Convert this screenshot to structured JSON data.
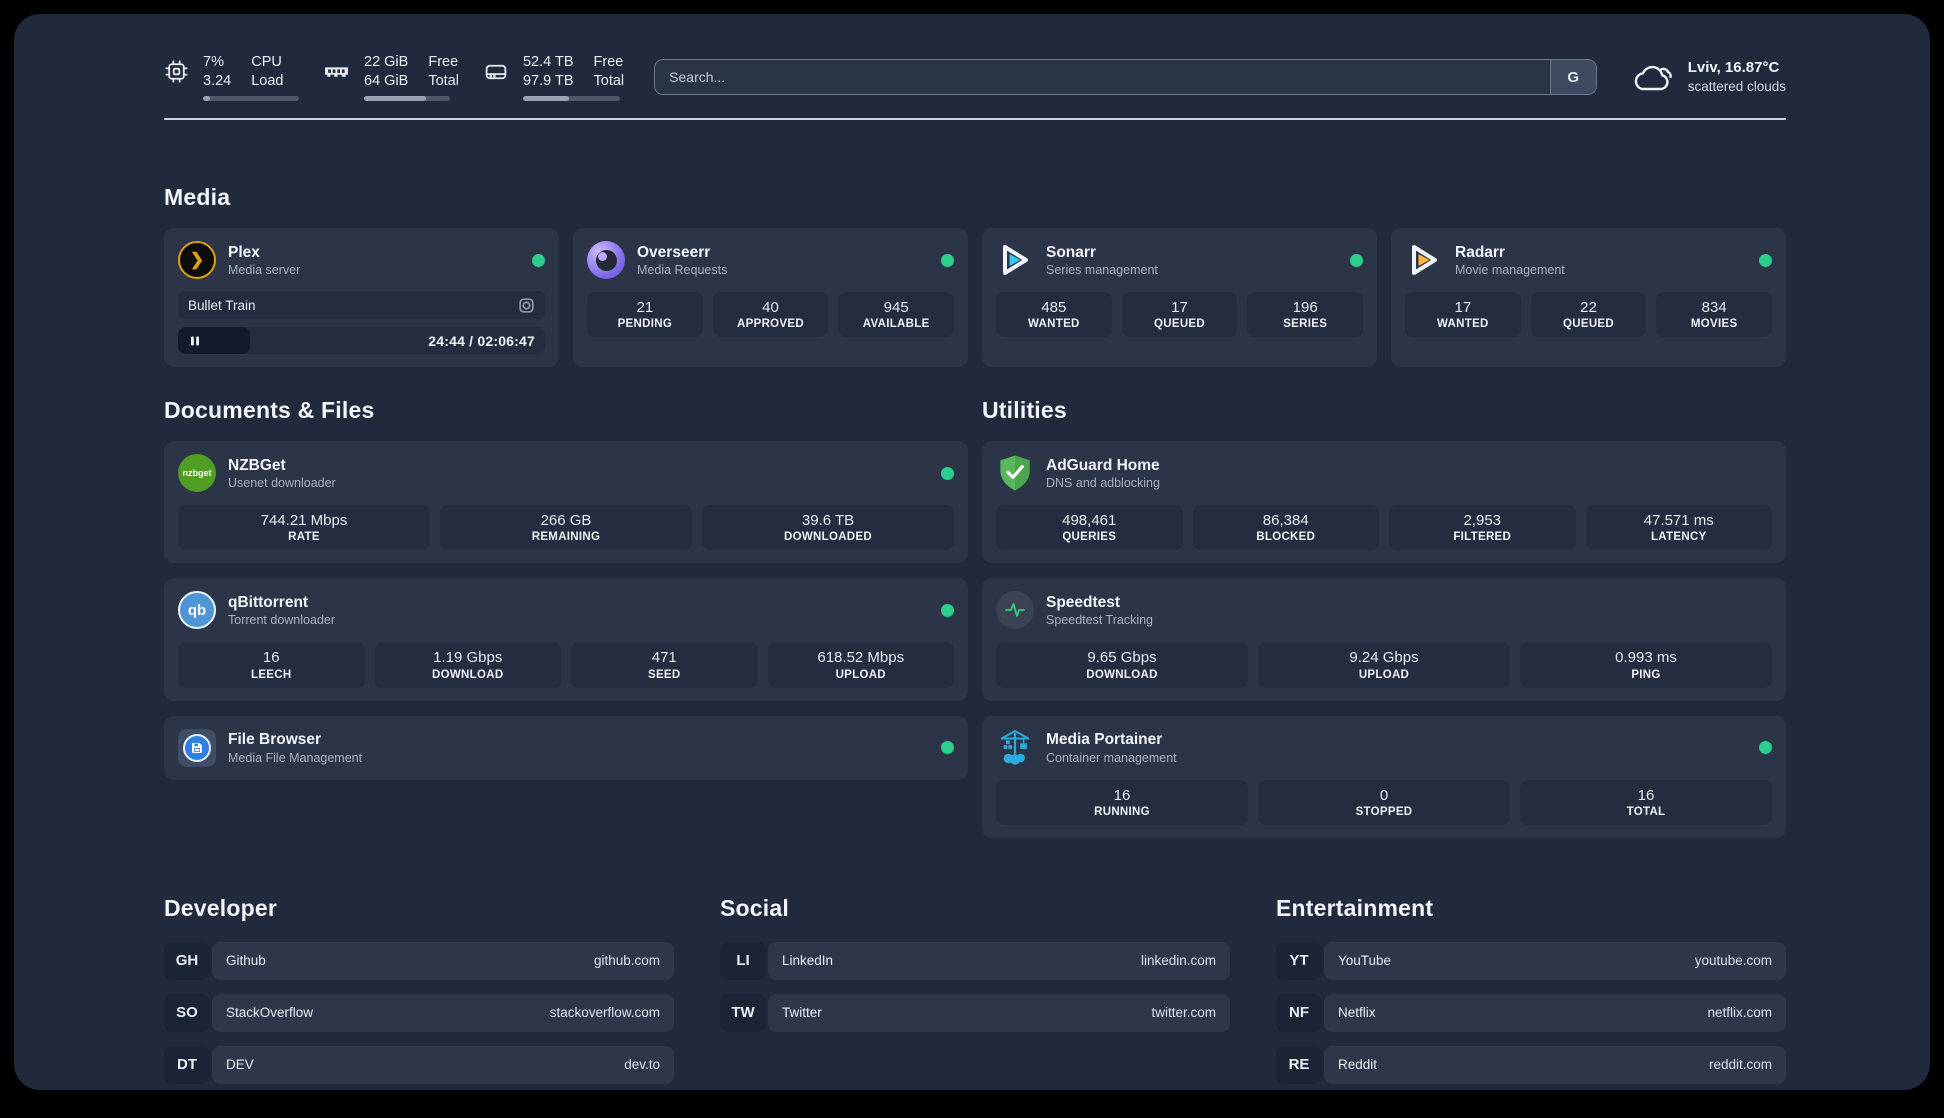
{
  "colors": {
    "status_online": "#2bce8d",
    "plex_orange": "#e5a00d",
    "sonarr_blue": "#38c6f4",
    "radarr_yellow": "#ffb53c",
    "adguard_green": "#5ab85c",
    "portainer_blue": "#2aabe2"
  },
  "header": {
    "cpu": {
      "value1": "7%",
      "value2": "3.24",
      "label1": "CPU",
      "label2": "Load",
      "progress_pct": 7
    },
    "memory": {
      "value1": "22 GiB",
      "value2": "64 GiB",
      "label1": "Free",
      "label2": "Total",
      "progress_pct": 72
    },
    "disk": {
      "value1": "52.4 TB",
      "value2": "97.9 TB",
      "label1": "Free",
      "label2": "Total",
      "progress_pct": 47
    },
    "search": {
      "placeholder": "Search...",
      "button_label": "G"
    },
    "weather": {
      "location_temp": "Lviv, 16.87°C",
      "condition": "scattered clouds"
    }
  },
  "sections": {
    "media": {
      "title": "Media"
    },
    "documents": {
      "title": "Documents & Files"
    },
    "utilities": {
      "title": "Utilities"
    }
  },
  "apps": {
    "plex": {
      "name": "Plex",
      "subtitle": "Media server",
      "now_playing": {
        "title": "Bullet Train",
        "time": "24:44 / 02:06:47",
        "progress_pct": 19.5
      }
    },
    "overseerr": {
      "name": "Overseerr",
      "subtitle": "Media Requests",
      "stats": [
        {
          "value": "21",
          "label": "PENDING"
        },
        {
          "value": "40",
          "label": "APPROVED"
        },
        {
          "value": "945",
          "label": "AVAILABLE"
        }
      ]
    },
    "sonarr": {
      "name": "Sonarr",
      "subtitle": "Series management",
      "stats": [
        {
          "value": "485",
          "label": "WANTED"
        },
        {
          "value": "17",
          "label": "QUEUED"
        },
        {
          "value": "196",
          "label": "SERIES"
        }
      ]
    },
    "radarr": {
      "name": "Radarr",
      "subtitle": "Movie management",
      "stats": [
        {
          "value": "17",
          "label": "WANTED"
        },
        {
          "value": "22",
          "label": "QUEUED"
        },
        {
          "value": "834",
          "label": "MOVIES"
        }
      ]
    },
    "nzbget": {
      "name": "NZBGet",
      "subtitle": "Usenet downloader",
      "icon_text": "nzbget",
      "stats": [
        {
          "value": "744.21 Mbps",
          "label": "RATE"
        },
        {
          "value": "266 GB",
          "label": "REMAINING"
        },
        {
          "value": "39.6 TB",
          "label": "DOWNLOADED"
        }
      ]
    },
    "qbittorrent": {
      "name": "qBittorrent",
      "subtitle": "Torrent downloader",
      "icon_text": "qb",
      "stats": [
        {
          "value": "16",
          "label": "LEECH"
        },
        {
          "value": "1.19 Gbps",
          "label": "DOWNLOAD"
        },
        {
          "value": "471",
          "label": "SEED"
        },
        {
          "value": "618.52 Mbps",
          "label": "UPLOAD"
        }
      ]
    },
    "filebrowser": {
      "name": "File Browser",
      "subtitle": "Media File Management"
    },
    "adguard": {
      "name": "AdGuard Home",
      "subtitle": "DNS and adblocking",
      "stats": [
        {
          "value": "498,461",
          "label": "QUERIES"
        },
        {
          "value": "86,384",
          "label": "BLOCKED"
        },
        {
          "value": "2,953",
          "label": "FILTERED"
        },
        {
          "value": "47.571 ms",
          "label": "LATENCY"
        }
      ]
    },
    "speedtest": {
      "name": "Speedtest",
      "subtitle": "Speedtest Tracking",
      "stats": [
        {
          "value": "9.65 Gbps",
          "label": "DOWNLOAD"
        },
        {
          "value": "9.24 Gbps",
          "label": "UPLOAD"
        },
        {
          "value": "0.993 ms",
          "label": "PING"
        }
      ]
    },
    "portainer": {
      "name": "Media Portainer",
      "subtitle": "Container management",
      "stats": [
        {
          "value": "16",
          "label": "RUNNING"
        },
        {
          "value": "0",
          "label": "STOPPED"
        },
        {
          "value": "16",
          "label": "TOTAL"
        }
      ]
    }
  },
  "bookmarks": {
    "developer": {
      "title": "Developer",
      "items": [
        {
          "tag": "GH",
          "name": "Github",
          "url": "github.com"
        },
        {
          "tag": "SO",
          "name": "StackOverflow",
          "url": "stackoverflow.com"
        },
        {
          "tag": "DT",
          "name": "DEV",
          "url": "dev.to"
        }
      ]
    },
    "social": {
      "title": "Social",
      "items": [
        {
          "tag": "LI",
          "name": "LinkedIn",
          "url": "linkedin.com"
        },
        {
          "tag": "TW",
          "name": "Twitter",
          "url": "twitter.com"
        }
      ]
    },
    "entertainment": {
      "title": "Entertainment",
      "items": [
        {
          "tag": "YT",
          "name": "YouTube",
          "url": "youtube.com"
        },
        {
          "tag": "NF",
          "name": "Netflix",
          "url": "netflix.com"
        },
        {
          "tag": "RE",
          "name": "Reddit",
          "url": "reddit.com"
        }
      ]
    }
  }
}
